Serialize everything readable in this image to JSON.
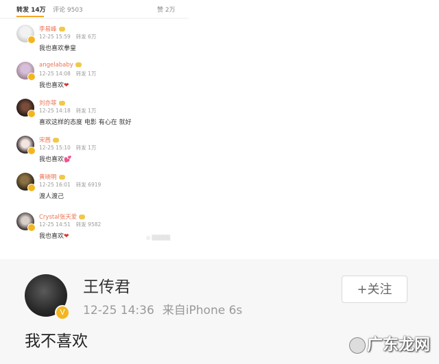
{
  "tabs": {
    "repost": "转发 14万",
    "comment": "评论 9503",
    "like": "赞 2万"
  },
  "comments": [
    {
      "name": "李易峰",
      "time": "12-25 15:59",
      "repost": "转发 6万",
      "text": "我也喜欢拳皇",
      "heart": ""
    },
    {
      "name": "angelababy",
      "time": "12-25 14:08",
      "repost": "转发 1万",
      "text": "我也喜欢",
      "heart": "❤"
    },
    {
      "name": "刘亦菲",
      "time": "12-25 14:18",
      "repost": "转发 1万",
      "text": "喜欢这样的态度 电影 有心在 就好",
      "heart": ""
    },
    {
      "name": "宋茜",
      "time": "12-25 15:10",
      "repost": "转发 1万",
      "text": "我也喜欢",
      "heart": "💕"
    },
    {
      "name": "黄晓明",
      "time": "12-25 16:01",
      "repost": "转发 6919",
      "text": "渡人渡己",
      "heart": ""
    },
    {
      "name": "Crystal张天爱",
      "time": "12-25 14:51",
      "repost": "转发 9582",
      "text": "我也喜欢",
      "heart": "❤"
    }
  ],
  "post": {
    "name": "王传君",
    "time": "12-25 14:36",
    "source": "来自iPhone 6s",
    "follow_label": "+关注",
    "text": "我不喜欢"
  },
  "watermark": "广东龙网",
  "colors": {
    "name": "#eb7350",
    "badge": "#f3b61f",
    "heart": "#d33a2c"
  }
}
